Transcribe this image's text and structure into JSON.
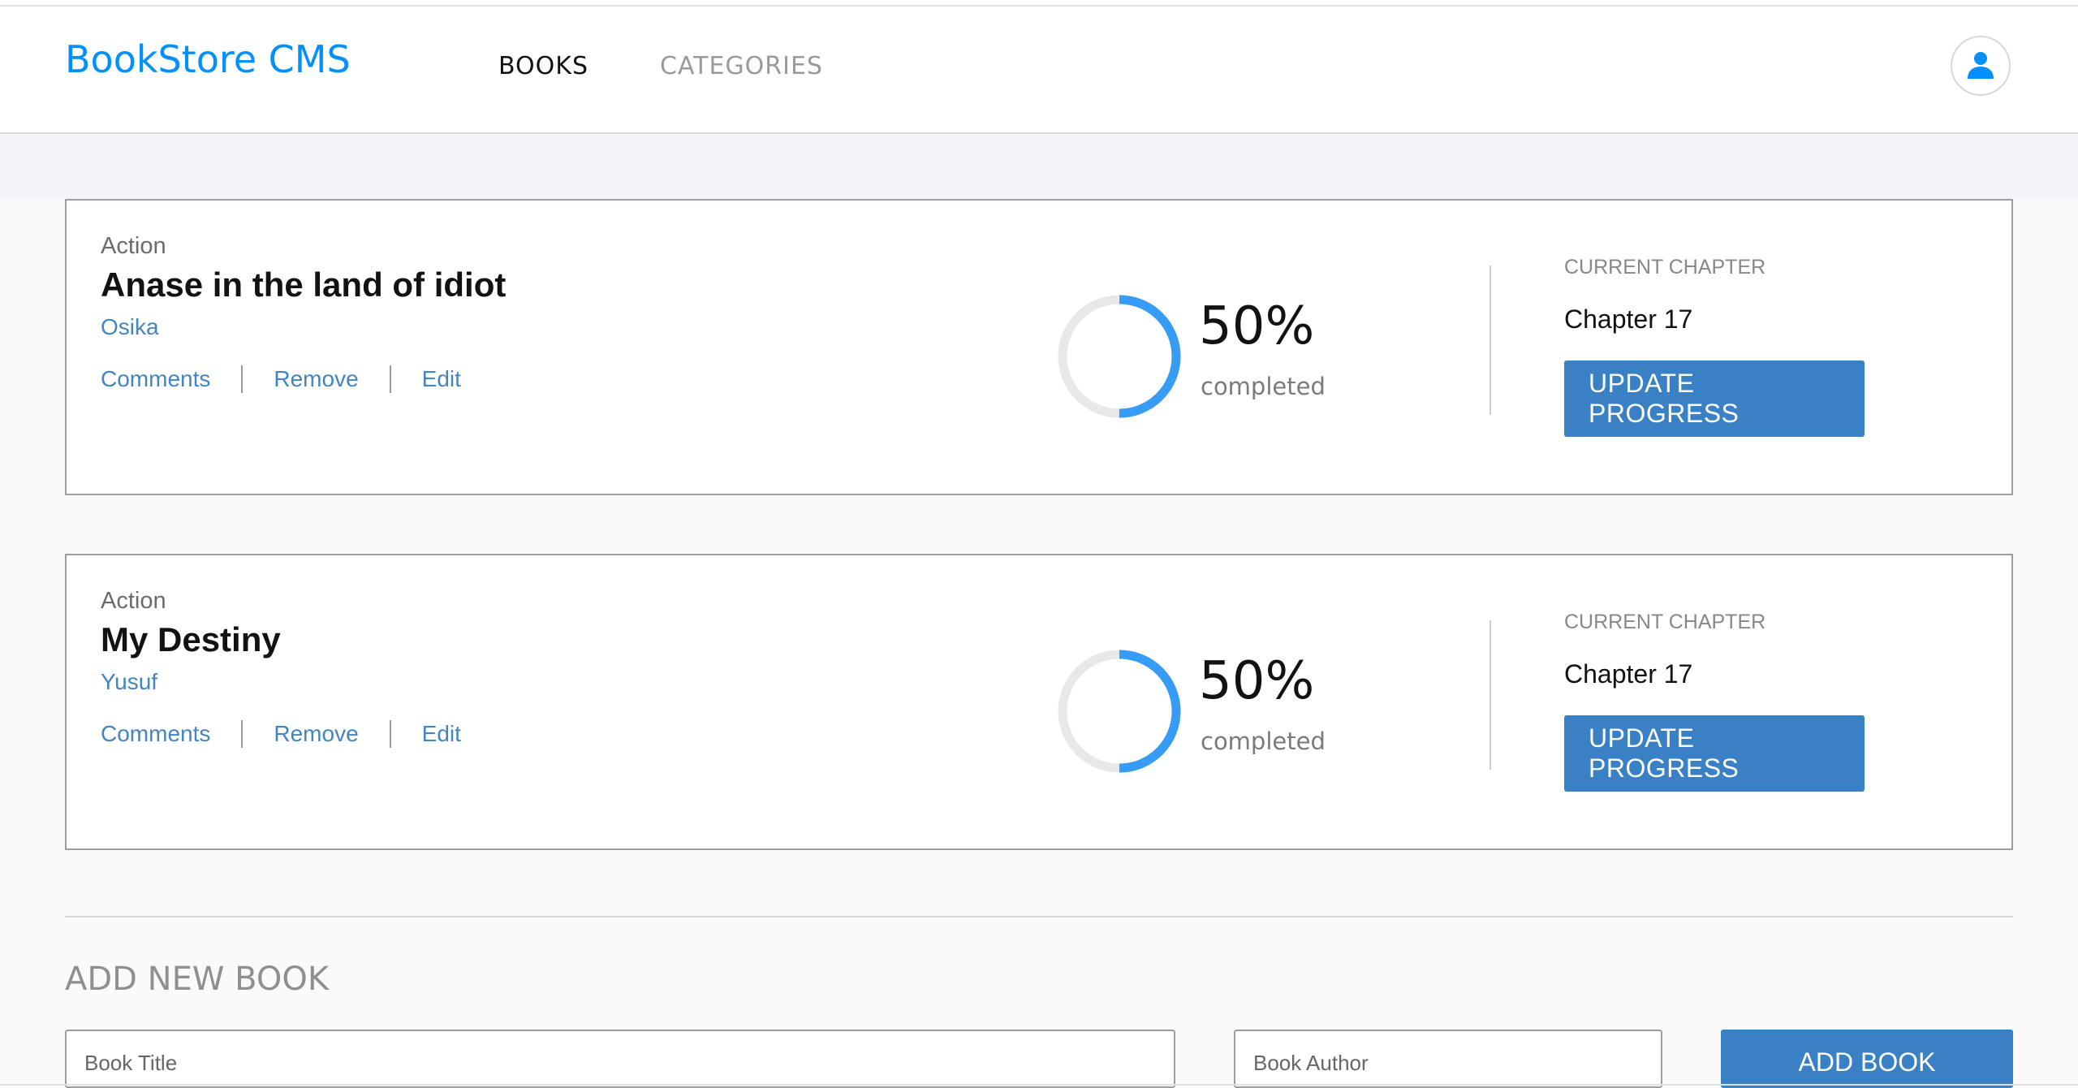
{
  "app": {
    "title": "BookStore CMS"
  },
  "nav": {
    "books": "BOOKS",
    "categories": "CATEGORIES"
  },
  "user": {
    "icon": "user-icon"
  },
  "books": [
    {
      "genre": "Action",
      "title": "Anase in the land of idiot",
      "author": "Osika",
      "actions": [
        "Comments",
        "Remove",
        "Edit"
      ],
      "progress_percent": 50,
      "progress_label": "50%",
      "completed_label": "completed",
      "current_chapter_label": "CURRENT CHAPTER",
      "current_chapter": "Chapter 17",
      "update_button": "UPDATE PROGRESS"
    },
    {
      "genre": "Action",
      "title": "My Destiny",
      "author": "Yusuf",
      "actions": [
        "Comments",
        "Remove",
        "Edit"
      ],
      "progress_percent": 50,
      "progress_label": "50%",
      "completed_label": "completed",
      "current_chapter_label": "CURRENT CHAPTER",
      "current_chapter": "Chapter 17",
      "update_button": "UPDATE PROGRESS"
    }
  ],
  "form": {
    "title": "ADD NEW BOOK",
    "title_placeholder": "Book Title",
    "author_placeholder": "Book Author",
    "submit_label": "ADD BOOK"
  },
  "colors": {
    "brand": "#0290ff",
    "accent": "#3a80c4",
    "link": "#4386bf",
    "progress": "#379cf6",
    "progress_track": "#e8e8e8"
  }
}
